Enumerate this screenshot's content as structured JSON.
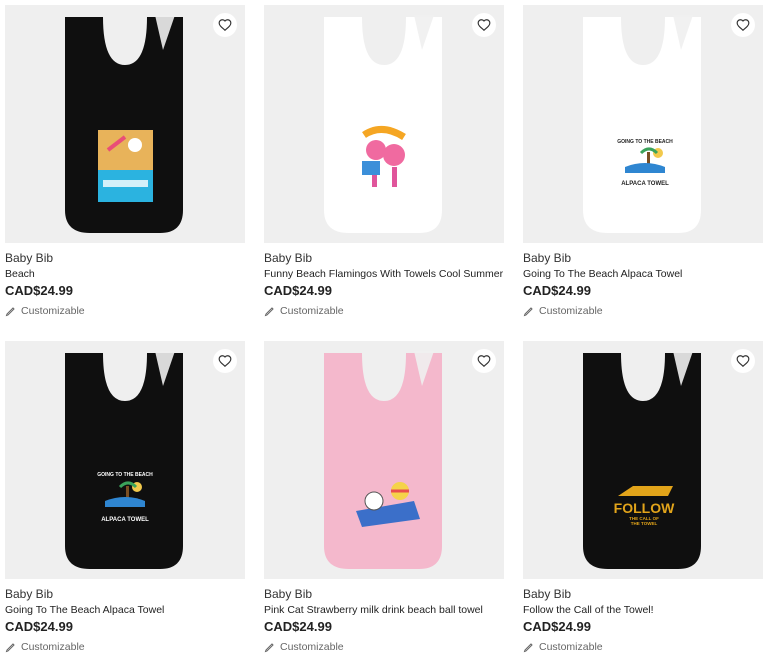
{
  "products": [
    {
      "type": "Baby Bib",
      "name": "Beach",
      "price": "CAD$24.99",
      "custom_label": "Customizable",
      "bib_color": "#0f0f0f",
      "design": "beach-scene"
    },
    {
      "type": "Baby Bib",
      "name": "Funny Beach Flamingos With Towels Cool Summer",
      "price": "CAD$24.99",
      "custom_label": "Customizable",
      "bib_color": "#ffffff",
      "design": "flamingos"
    },
    {
      "type": "Baby Bib",
      "name": "Going To The Beach Alpaca Towel",
      "price": "CAD$24.99",
      "custom_label": "Customizable",
      "bib_color": "#ffffff",
      "design": "alpaca-towel",
      "design_text": [
        "GOING TO THE BEACH",
        "ALPACA TOWEL"
      ]
    },
    {
      "type": "Baby Bib",
      "name": "Going To The Beach Alpaca Towel",
      "price": "CAD$24.99",
      "custom_label": "Customizable",
      "bib_color": "#0f0f0f",
      "design": "alpaca-towel",
      "design_text": [
        "GOING TO THE BEACH",
        "ALPACA TOWEL"
      ]
    },
    {
      "type": "Baby Bib",
      "name": "Pink Cat Strawberry milk drink beach ball towel",
      "price": "CAD$24.99",
      "custom_label": "Customizable",
      "bib_color": "#f4b8cc",
      "design": "pink-cat"
    },
    {
      "type": "Baby Bib",
      "name": "Follow the Call of the Towel!",
      "price": "CAD$24.99",
      "custom_label": "Customizable",
      "bib_color": "#0f0f0f",
      "design": "follow",
      "design_text": [
        "FOLLOW",
        "THE CALL OF",
        "THE TOWEL"
      ]
    }
  ],
  "icons": {
    "favorite": "heart-outline-icon",
    "customizable": "pencil-icon"
  }
}
